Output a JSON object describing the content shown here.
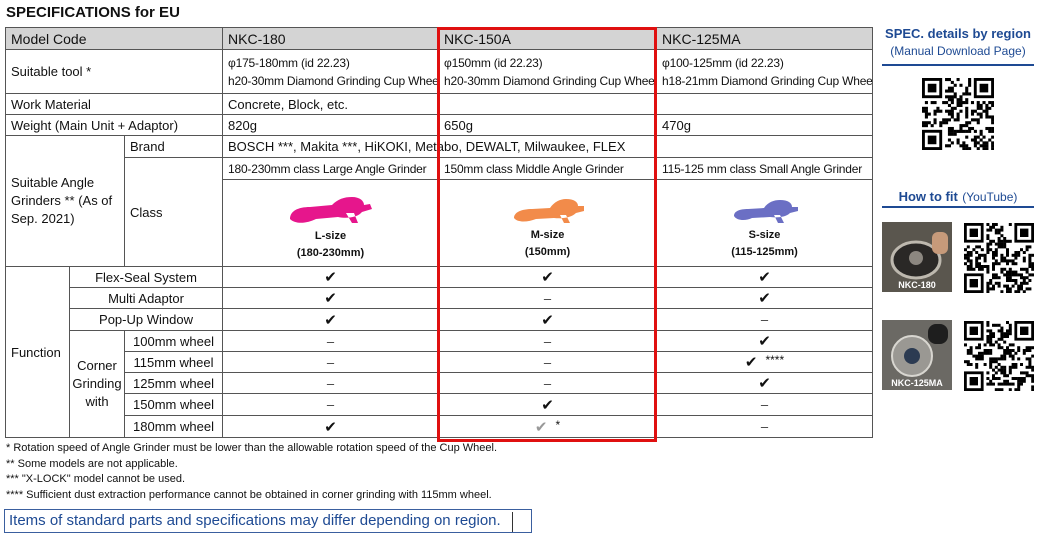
{
  "page_title": "SPECIFICATIONS for EU",
  "header": {
    "label": "Model Code",
    "models": [
      "NKC-180",
      "NKC-150A",
      "NKC-125MA"
    ]
  },
  "suitable_tool": {
    "label": "Suitable tool *",
    "values": [
      {
        "line1": "φ175-180mm (id 22.23)",
        "line2": "h20-30mm Diamond Grinding Cup Wheel"
      },
      {
        "line1": "φ150mm (id 22.23)",
        "line2": "h20-30mm Diamond Grinding Cup Wheel"
      },
      {
        "line1": "φ100-125mm (id 22.23)",
        "line2": "h18-21mm Diamond Grinding Cup Wheel"
      }
    ]
  },
  "work_material": {
    "label": "Work Material",
    "value": "Concrete, Block,  etc."
  },
  "weight": {
    "label": "Weight (Main Unit + Adaptor)",
    "values": [
      "820g",
      "650g",
      "470g"
    ]
  },
  "grinders": {
    "group_label": "Suitable Angle Grinders ** (As of Sep. 2021)",
    "brand_label": "Brand",
    "brands": "BOSCH ***, Makita ***, HiKOKI, Metabo, DEWALT, Milwaukee, FLEX",
    "class_label": "Class",
    "classes": [
      "180-230mm class Large Angle Grinder",
      "150mm class Middle Angle Grinder",
      "115-125 mm class Small Angle Grinder"
    ],
    "sizes": [
      {
        "name": "L-size",
        "range": "(180-230mm)",
        "color": "#e6168c"
      },
      {
        "name": "M-size",
        "range": "(150mm)",
        "color": "#f28b4a"
      },
      {
        "name": "S-size",
        "range": "(115-125mm)",
        "color": "#6b6fc4"
      }
    ]
  },
  "function": {
    "label": "Function",
    "rows": [
      {
        "label": "Flex-Seal System",
        "values": [
          "✔",
          "✔",
          "✔"
        ]
      },
      {
        "label": "Multi Adaptor",
        "values": [
          "✔",
          "–",
          "✔"
        ]
      },
      {
        "label": "Pop-Up Window",
        "values": [
          "✔",
          "✔",
          "–"
        ]
      }
    ],
    "corner_label": "Corner Grinding with",
    "corner_rows": [
      {
        "label": "100mm wheel",
        "values": [
          "–",
          "–",
          "✔"
        ]
      },
      {
        "label": "115mm wheel",
        "values": [
          "–",
          "–",
          "✔"
        ],
        "note3": "****"
      },
      {
        "label": "125mm wheel",
        "values": [
          "–",
          "–",
          "✔"
        ]
      },
      {
        "label": "150mm wheel",
        "values": [
          "–",
          "✔",
          "–"
        ]
      },
      {
        "label": "180mm wheel",
        "values": [
          "✔",
          "✔",
          "–"
        ],
        "note2": "*"
      }
    ]
  },
  "notes": [
    "*  Rotation speed of Angle Grinder must be lower than the allowable rotation speed of the Cup Wheel.",
    "**  Some models are not applicable.",
    "***  \"X-LOCK\" model cannot be used.",
    "****  Sufficient dust extraction performance cannot be obtained in corner grinding with 115mm wheel."
  ],
  "notice": "Items of standard parts and specifications may differ depending on region.",
  "sidebar": {
    "spec_title": "SPEC. details by region",
    "spec_sub": "(Manual Download Page)",
    "fit_title": "How to fit",
    "fit_sub": "(YouTube)",
    "videos": [
      {
        "label": "NKC-180"
      },
      {
        "label": "NKC-125MA"
      }
    ]
  },
  "colors": {
    "highlight": "#e01010",
    "link_blue": "#1e4a93",
    "header_gray": "#d4d4d4"
  }
}
